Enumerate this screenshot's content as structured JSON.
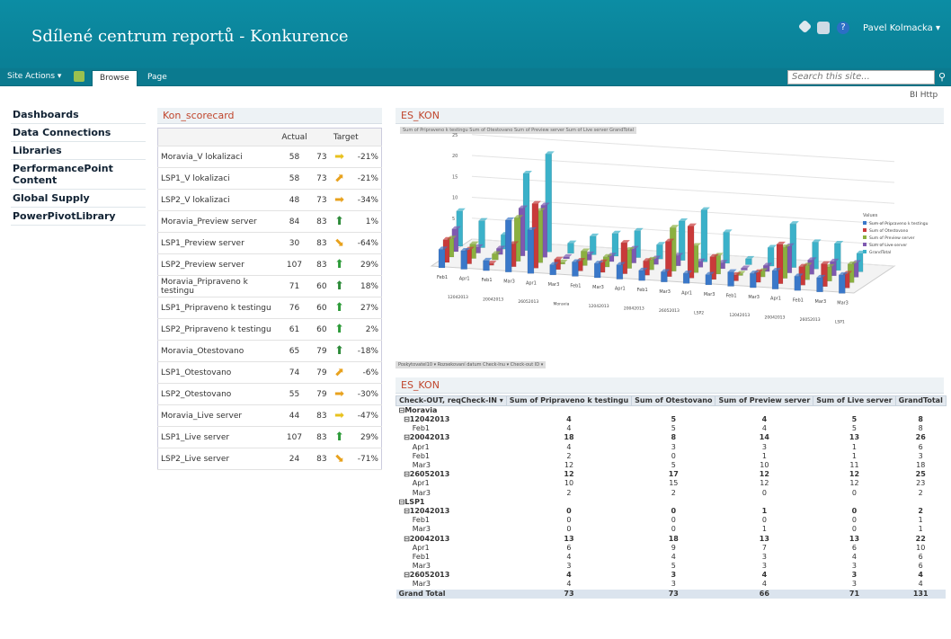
{
  "header": {
    "title": "Sdílené centrum reportů - Konkurence",
    "user": "Pavel Kolmacka ▾"
  },
  "ribbon": {
    "site_actions": "Site Actions ▾",
    "tab_browse": "Browse",
    "tab_page": "Page",
    "search_placeholder": "Search this site..."
  },
  "bi_link": "BI Http",
  "nav": [
    "Dashboards",
    "Data Connections",
    "Libraries",
    "PerformancePoint Content",
    "Global Supply",
    "PowerPivotLibrary"
  ],
  "scorecard": {
    "title": "Kon_scorecard",
    "col_actual": "Actual",
    "col_target": "Target",
    "rows": [
      {
        "name": "Moravia_V lokalizaci",
        "actual": "58",
        "target": "73",
        "pct": "-21%",
        "icon": "arrow-right",
        "color": "#e8c21e"
      },
      {
        "name": "LSP1_V lokalizaci",
        "actual": "58",
        "target": "73",
        "pct": "-21%",
        "icon": "arrow-up-right",
        "color": "#e8a21e"
      },
      {
        "name": "LSP2_V lokalizaci",
        "actual": "48",
        "target": "73",
        "pct": "-34%",
        "icon": "arrow-right",
        "color": "#e8a21e"
      },
      {
        "name": "Moravia_Preview server",
        "actual": "84",
        "target": "83",
        "pct": "1%",
        "icon": "arrow-up",
        "color": "#2e8b3a"
      },
      {
        "name": "LSP1_Preview server",
        "actual": "30",
        "target": "83",
        "pct": "-64%",
        "icon": "arrow-down-right",
        "color": "#e8a21e"
      },
      {
        "name": "LSP2_Preview server",
        "actual": "107",
        "target": "83",
        "pct": "29%",
        "icon": "arrow-up",
        "color": "#2e9b3a"
      },
      {
        "name": "Moravia_Pripraveno k testingu",
        "actual": "71",
        "target": "60",
        "pct": "18%",
        "icon": "arrow-up",
        "color": "#2e8b3a"
      },
      {
        "name": "LSP1_Pripraveno k testingu",
        "actual": "76",
        "target": "60",
        "pct": "27%",
        "icon": "arrow-up",
        "color": "#2e9b3a"
      },
      {
        "name": "LSP2_Pripraveno k testingu",
        "actual": "61",
        "target": "60",
        "pct": "2%",
        "icon": "arrow-up",
        "color": "#2e9b3a"
      },
      {
        "name": "Moravia_Otestovano",
        "actual": "65",
        "target": "79",
        "pct": "-18%",
        "icon": "arrow-up",
        "color": "#2e8b3a"
      },
      {
        "name": "LSP1_Otestovano",
        "actual": "74",
        "target": "79",
        "pct": "-6%",
        "icon": "arrow-up-right",
        "color": "#e8a21e"
      },
      {
        "name": "LSP2_Otestovano",
        "actual": "55",
        "target": "79",
        "pct": "-30%",
        "icon": "arrow-right",
        "color": "#e8a21e"
      },
      {
        "name": "Moravia_Live server",
        "actual": "44",
        "target": "83",
        "pct": "-47%",
        "icon": "arrow-right",
        "color": "#e8c21e"
      },
      {
        "name": "LSP1_Live server",
        "actual": "107",
        "target": "83",
        "pct": "29%",
        "icon": "arrow-up",
        "color": "#2e9b3a"
      },
      {
        "name": "LSP2_Live server",
        "actual": "24",
        "target": "83",
        "pct": "-71%",
        "icon": "arrow-down-right",
        "color": "#e8a21e"
      }
    ]
  },
  "chart_title": "ES_KON",
  "chart_header_strip": "Sum of Pripraveno k testingu  Sum of Otestovano  Sum of Preview server  Sum of Live server  GrandTotal",
  "chart_filters": "Poskytovatel10 ▾  Rozsekovaní datum Check-Inu ▾  Check-out ID ▾",
  "chart_data": {
    "type": "bar",
    "categories": [
      "Feb1",
      "Apr1",
      "Feb1",
      "Mar3",
      "Apr1",
      "Mar3",
      "Feb1",
      "Mar3",
      "Apr1",
      "Feb1",
      "Mar3",
      "Apr1",
      "Mar3",
      "Feb1",
      "Mar3",
      "Apr1",
      "Feb1",
      "Mar3",
      "Mar3"
    ],
    "group_labels": [
      "12042013",
      "20042013",
      "26052013",
      "Moravia",
      "12042013",
      "20042013",
      "26052013",
      "LSP2",
      "12042013",
      "20042013",
      "26052013",
      "LSP1"
    ],
    "yticks": [
      "0",
      "5",
      "10",
      "15",
      "20",
      "25"
    ],
    "legend_title": "Values",
    "series": [
      {
        "name": "Sum of Pripraveno k testingu",
        "color": "#3a78c9",
        "values": [
          4,
          4,
          2,
          12,
          10,
          2,
          3,
          3,
          3,
          2,
          2,
          2,
          2,
          3,
          3,
          4,
          3,
          3,
          4
        ]
      },
      {
        "name": "Sum of Otestovano",
        "color": "#c93a3a",
        "values": [
          5,
          3,
          0,
          5,
          15,
          2,
          2,
          2,
          7,
          3,
          8,
          12,
          5,
          1,
          2,
          9,
          4,
          5,
          3
        ]
      },
      {
        "name": "Sum of Preview server",
        "color": "#8bb040",
        "values": [
          4,
          3,
          1,
          10,
          12,
          0,
          3,
          2,
          4,
          2,
          10,
          6,
          4,
          0,
          1,
          7,
          3,
          3,
          4
        ]
      },
      {
        "name": "Sum of Live server",
        "color": "#7e59b0",
        "values": [
          5,
          1,
          1,
          11,
          12,
          0,
          1,
          1,
          3,
          1,
          2,
          1,
          1,
          0,
          1,
          6,
          3,
          3,
          3
        ]
      },
      {
        "name": "GrandTotal",
        "color": "#3bb1c9",
        "values": [
          8,
          6,
          3,
          18,
          23,
          2,
          4,
          5,
          6,
          3,
          9,
          12,
          7,
          1,
          4,
          10,
          6,
          6,
          4
        ]
      }
    ]
  },
  "pivot": {
    "title": "ES_KON",
    "headers": [
      "Check-OUT, reqCheck-IN ▾",
      "Sum of Pripraveno k testingu",
      "Sum of Otestovano",
      "Sum of Preview server",
      "Sum of Live server",
      "GrandTotal"
    ],
    "rows": [
      {
        "t": "b",
        "c": [
          "⊟Moravia",
          "",
          "",
          "",
          "",
          ""
        ]
      },
      {
        "t": "b",
        "c": [
          "  ⊟12042013",
          "4",
          "5",
          "4",
          "5",
          "8"
        ]
      },
      {
        "t": "n",
        "c": [
          "      Feb1",
          "4",
          "5",
          "4",
          "5",
          "8"
        ]
      },
      {
        "t": "b",
        "c": [
          "  ⊟20042013",
          "18",
          "8",
          "14",
          "13",
          "26"
        ]
      },
      {
        "t": "n",
        "c": [
          "      Apr1",
          "4",
          "3",
          "3",
          "1",
          "6"
        ]
      },
      {
        "t": "n",
        "c": [
          "      Feb1",
          "2",
          "0",
          "1",
          "1",
          "3"
        ]
      },
      {
        "t": "n",
        "c": [
          "      Mar3",
          "12",
          "5",
          "10",
          "11",
          "18"
        ]
      },
      {
        "t": "b",
        "c": [
          "  ⊟26052013",
          "12",
          "17",
          "12",
          "12",
          "25"
        ]
      },
      {
        "t": "n",
        "c": [
          "      Apr1",
          "10",
          "15",
          "12",
          "12",
          "23"
        ]
      },
      {
        "t": "n",
        "c": [
          "      Mar3",
          "2",
          "2",
          "0",
          "0",
          "2"
        ]
      },
      {
        "t": "b",
        "c": [
          "⊟LSP1",
          "",
          "",
          "",
          "",
          ""
        ]
      },
      {
        "t": "b",
        "c": [
          "  ⊟12042013",
          "0",
          "0",
          "1",
          "0",
          "2"
        ]
      },
      {
        "t": "n",
        "c": [
          "      Feb1",
          "0",
          "0",
          "0",
          "0",
          "1"
        ]
      },
      {
        "t": "n",
        "c": [
          "      Mar3",
          "0",
          "0",
          "1",
          "0",
          "1"
        ]
      },
      {
        "t": "b",
        "c": [
          "  ⊟20042013",
          "13",
          "18",
          "13",
          "13",
          "22"
        ]
      },
      {
        "t": "n",
        "c": [
          "      Apr1",
          "6",
          "9",
          "7",
          "6",
          "10"
        ]
      },
      {
        "t": "n",
        "c": [
          "      Feb1",
          "4",
          "4",
          "3",
          "4",
          "6"
        ]
      },
      {
        "t": "n",
        "c": [
          "      Mar3",
          "3",
          "5",
          "3",
          "3",
          "6"
        ]
      },
      {
        "t": "b",
        "c": [
          "  ⊟26052013",
          "4",
          "3",
          "4",
          "3",
          "4"
        ]
      },
      {
        "t": "n",
        "c": [
          "      Mar3",
          "4",
          "3",
          "4",
          "3",
          "4"
        ]
      },
      {
        "t": "gt",
        "c": [
          "Grand Total",
          "73",
          "73",
          "66",
          "71",
          "131"
        ]
      }
    ]
  }
}
